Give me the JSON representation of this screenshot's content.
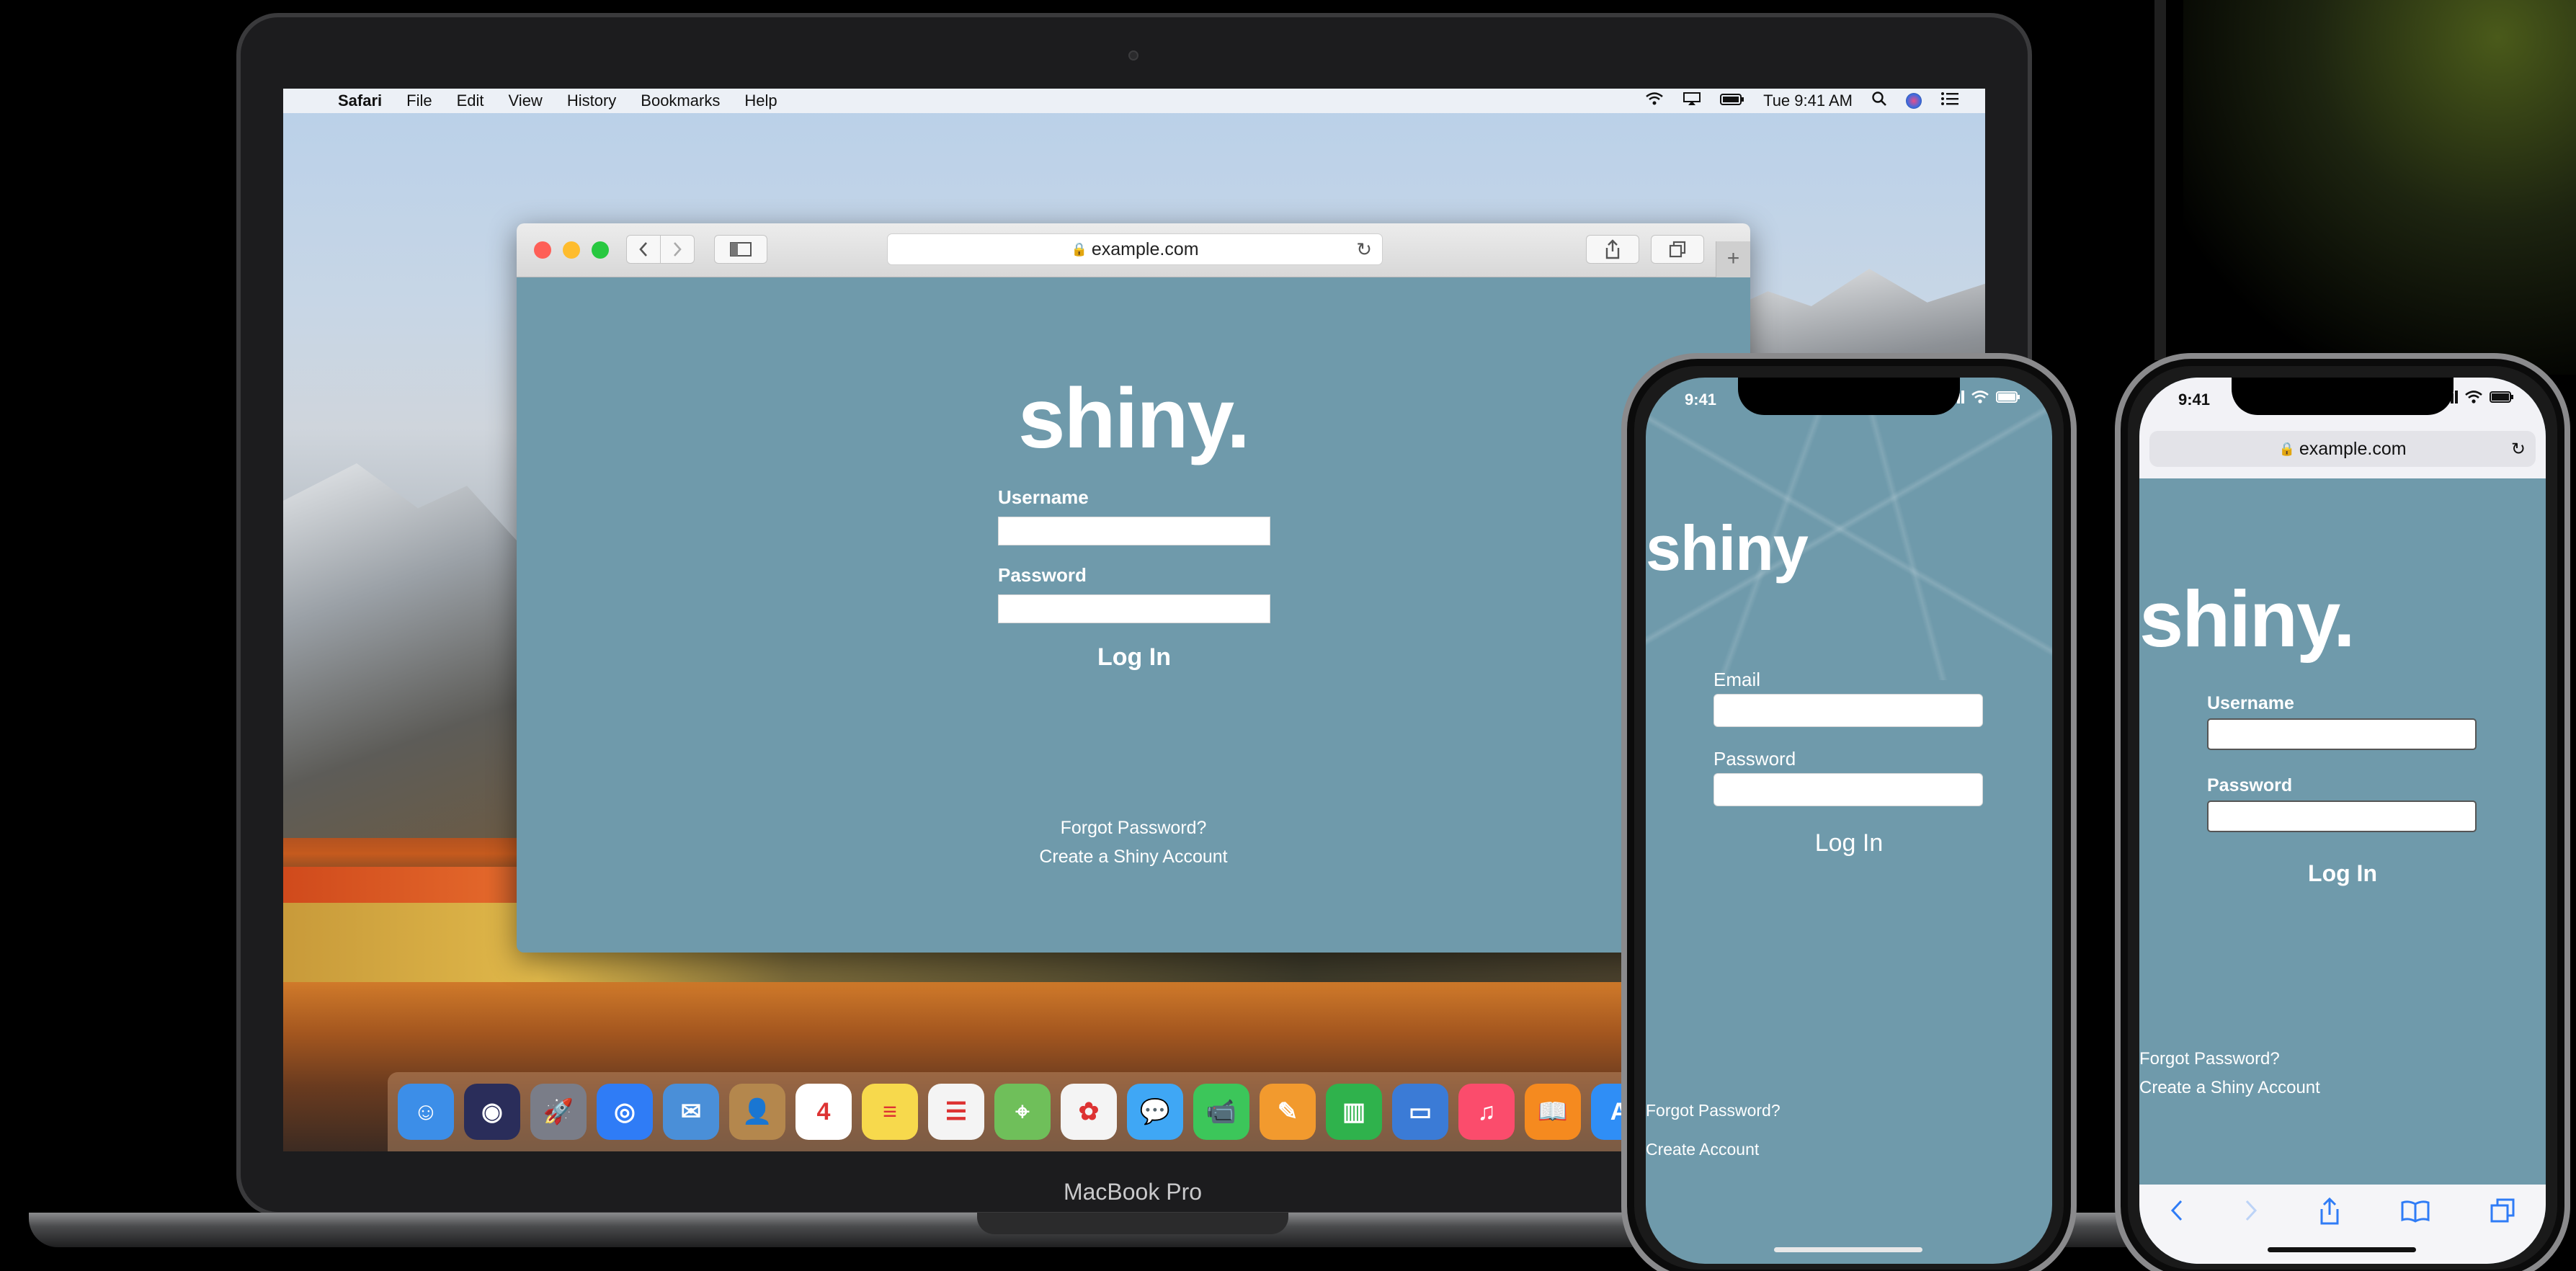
{
  "mac": {
    "menubar": {
      "app_name": "Safari",
      "items": [
        "File",
        "Edit",
        "View",
        "History",
        "Bookmarks",
        "Help"
      ],
      "clock": "Tue 9:41 AM"
    },
    "safari": {
      "url": "example.com"
    },
    "site": {
      "logo": "shiny.",
      "username_label": "Username",
      "password_label": "Password",
      "login_label": "Log In",
      "forgot_link": "Forgot Password?",
      "create_link": "Create a Shiny Account"
    },
    "dock_apps": [
      {
        "name": "finder",
        "color": "#3c8ee8",
        "glyph": "☺"
      },
      {
        "name": "siri",
        "color": "#2a2d5a",
        "glyph": "◉"
      },
      {
        "name": "launchpad",
        "color": "#7a7d88",
        "glyph": "🚀"
      },
      {
        "name": "safari",
        "color": "#2f7cf6",
        "glyph": "◎"
      },
      {
        "name": "mail",
        "color": "#4a8fd8",
        "glyph": "✉"
      },
      {
        "name": "contacts",
        "color": "#b4874d",
        "glyph": "👤"
      },
      {
        "name": "calendar",
        "color": "#ffffff",
        "glyph": "4"
      },
      {
        "name": "notes",
        "color": "#f7d94c",
        "glyph": "≡"
      },
      {
        "name": "reminders",
        "color": "#f4f4f4",
        "glyph": "☰"
      },
      {
        "name": "maps",
        "color": "#6fbf5a",
        "glyph": "⌖"
      },
      {
        "name": "photos",
        "color": "#f4f4f4",
        "glyph": "✿"
      },
      {
        "name": "messages",
        "color": "#3fa7f5",
        "glyph": "💬"
      },
      {
        "name": "facetime",
        "color": "#3cc65a",
        "glyph": "📹"
      },
      {
        "name": "pages",
        "color": "#f29a2e",
        "glyph": "✎"
      },
      {
        "name": "numbers",
        "color": "#2fb24c",
        "glyph": "▥"
      },
      {
        "name": "keynote",
        "color": "#3b7bd6",
        "glyph": "▭"
      },
      {
        "name": "music",
        "color": "#fb4c6c",
        "glyph": "♫"
      },
      {
        "name": "books",
        "color": "#f58a1f",
        "glyph": "📖"
      },
      {
        "name": "app-store",
        "color": "#2f8ef6",
        "glyph": "A"
      }
    ],
    "model_label": "MacBook Pro"
  },
  "phone_app": {
    "time": "9:41",
    "logo": "shiny",
    "email_label": "Email",
    "password_label": "Password",
    "login_label": "Log In",
    "forgot_link": "Forgot Password?",
    "create_link": "Create Account"
  },
  "phone_web": {
    "time": "9:41",
    "url": "example.com",
    "logo": "shiny.",
    "username_label": "Username",
    "password_label": "Password",
    "login_label": "Log In",
    "forgot_link": "Forgot Password?",
    "create_link": "Create a Shiny Account"
  },
  "colors": {
    "site_background": "#6f9aab",
    "ios_tint": "#2f7cf6"
  }
}
